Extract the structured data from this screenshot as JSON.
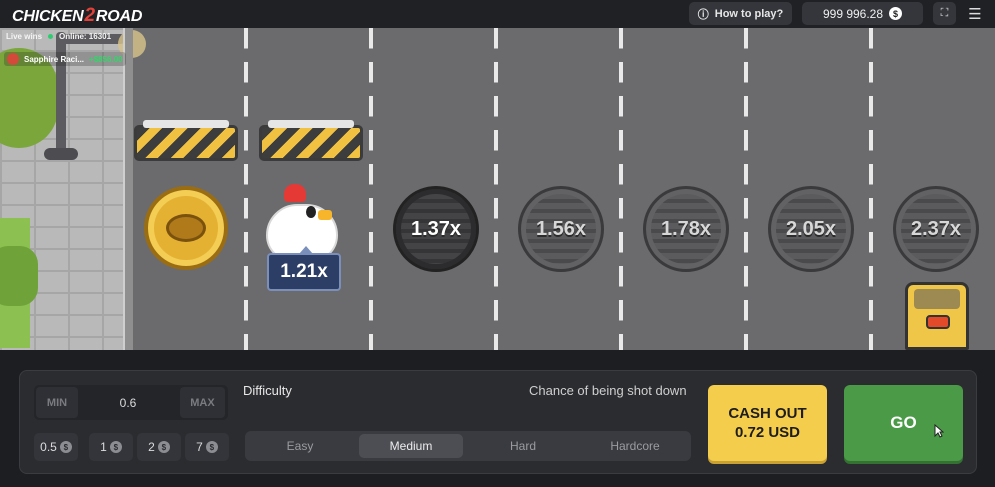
{
  "header": {
    "logo_left": "CHICKEN",
    "logo_mid": "2",
    "logo_right": "ROAD",
    "how_to_play": "How to play?",
    "balance": "999 996.28",
    "currency_symbol": "$"
  },
  "live": {
    "title": "Live wins",
    "online": "Online: 16301",
    "player": "Sapphire Raci...",
    "amount": "+$856.00"
  },
  "game": {
    "current_multiplier": "1.21x",
    "lanes": [
      "1.37x",
      "1.56x",
      "1.78x",
      "2.05x",
      "2.37x"
    ]
  },
  "bet": {
    "min_label": "MIN",
    "value": "0.6",
    "max_label": "MAX",
    "chips": [
      "0.5",
      "1",
      "2",
      "7"
    ],
    "chip_symbol": "$"
  },
  "difficulty": {
    "label": "Difficulty",
    "chance_label": "Chance of being shot down",
    "options": [
      "Easy",
      "Medium",
      "Hard",
      "Hardcore"
    ],
    "selected": "Medium"
  },
  "actions": {
    "cashout_line1": "CASH OUT",
    "cashout_line2": "0.72 USD",
    "go": "GO"
  },
  "colors": {
    "go": "#4a9a47",
    "cashout": "#f5cd4c",
    "win_amount": "#36d46b"
  }
}
